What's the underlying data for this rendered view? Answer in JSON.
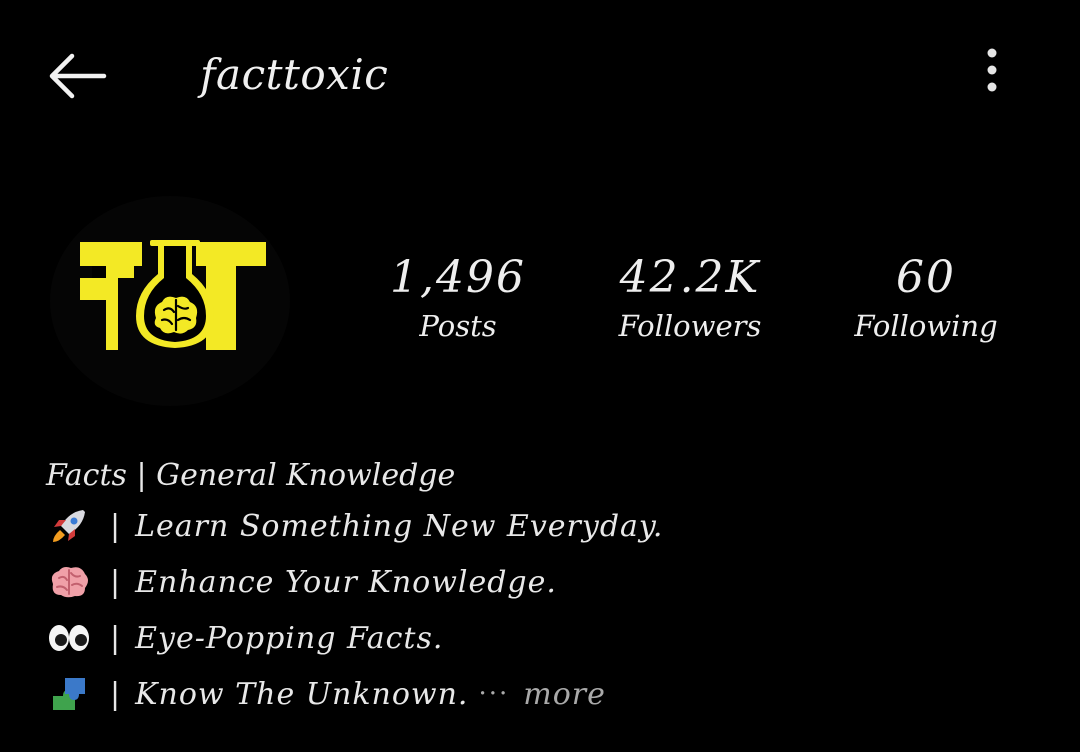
{
  "header": {
    "username": "facttoxic",
    "back_icon": "arrow-left-icon",
    "menu_icon": "vertical-dots-icon"
  },
  "profile": {
    "avatar_icon": "flask-brain-logo",
    "avatar_logo_color": "#f3e925"
  },
  "stats": [
    {
      "value": "1,496",
      "label": "Posts"
    },
    {
      "value": "42.2K",
      "label": "Followers"
    },
    {
      "value": "60",
      "label": "Following"
    }
  ],
  "bio": {
    "title": "Facts | General Knowledge",
    "lines": [
      {
        "icon": "rocket-icon",
        "text": "Learn Something New Everyday."
      },
      {
        "icon": "brain-icon",
        "text": "Enhance Your Knowledge."
      },
      {
        "icon": "eyes-icon",
        "text": "Eye-Popping Facts."
      },
      {
        "icon": "puzzle-icon",
        "text": "Know The Unknown."
      }
    ],
    "separator": "|",
    "ellipsis": "···",
    "more_label": "more"
  }
}
